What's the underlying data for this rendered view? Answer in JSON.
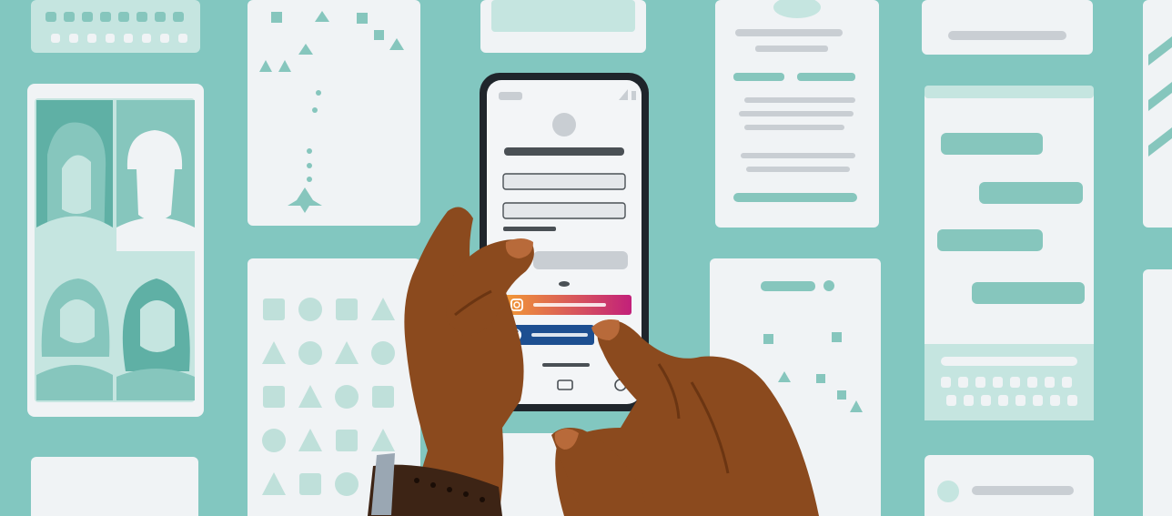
{
  "palette": {
    "background": "#82c7c0",
    "card": "#f0f3f5",
    "card_teal": "#c5e5e0",
    "teal_shape": "#86c6bd",
    "teal_dark": "#5fb0a5",
    "gray_line": "#c9ced3",
    "gray_dark": "#4a5055",
    "phone_frame": "#1f252b",
    "phone_screen": "#f3f5f7",
    "skin": "#8b4a1e",
    "skin_shadow": "#6b3512",
    "nail": "#b86a3a",
    "watch_band": "#3d2415",
    "watch_face": "#9aa7b3",
    "instagram_start": "#f29a35",
    "instagram_end": "#c2207a",
    "facebook": "#1d4f91"
  },
  "illustration": {
    "background_screens": [
      {
        "kind": "keyboard"
      },
      {
        "kind": "game-screen"
      },
      {
        "kind": "image-card"
      },
      {
        "kind": "text-article"
      },
      {
        "kind": "search-bar"
      },
      {
        "kind": "video-call-grid"
      },
      {
        "kind": "shapes-grid"
      },
      {
        "kind": "chat-messages"
      },
      {
        "kind": "game-screen-small"
      },
      {
        "kind": "list-card"
      },
      {
        "kind": "blank-card"
      }
    ],
    "phone": {
      "kind": "sign-in-screen",
      "fields": 2,
      "social_buttons": [
        "instagram",
        "facebook"
      ],
      "nav_bar": [
        "back",
        "home",
        "recents"
      ]
    },
    "hands": [
      "left-hand-holding-phone",
      "right-hand-tapping"
    ],
    "wrist_accessory": "smartwatch"
  }
}
